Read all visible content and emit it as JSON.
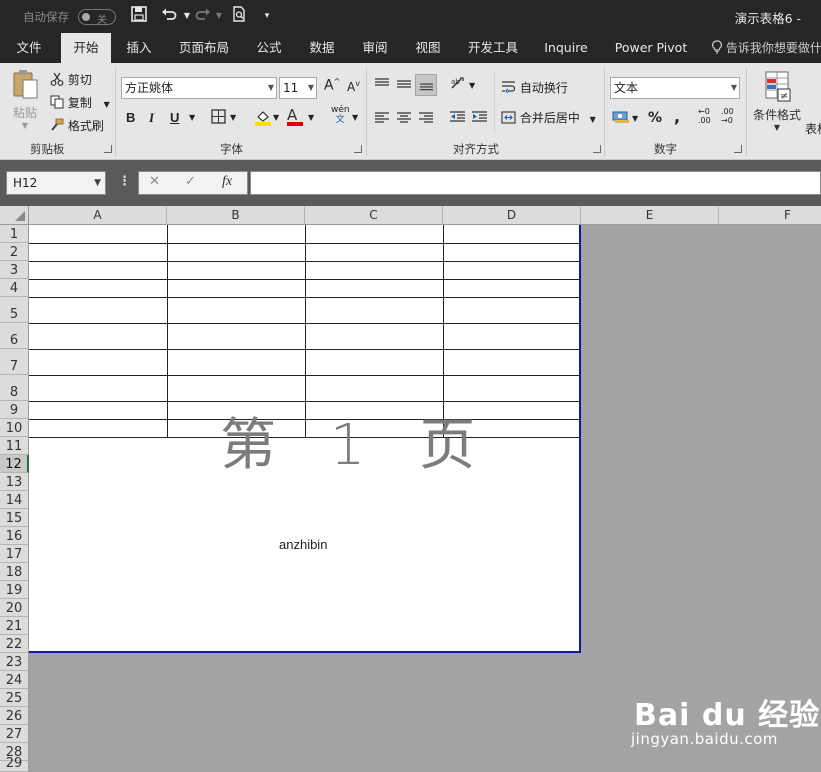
{
  "titlebar": {
    "autosave_label": "自动保存",
    "autosave_state": "关",
    "document_title": "演示表格6 -"
  },
  "tabs": [
    {
      "label": "文件"
    },
    {
      "label": "开始"
    },
    {
      "label": "插入"
    },
    {
      "label": "页面布局"
    },
    {
      "label": "公式"
    },
    {
      "label": "数据"
    },
    {
      "label": "审阅"
    },
    {
      "label": "视图"
    },
    {
      "label": "开发工具"
    },
    {
      "label": "Inquire"
    },
    {
      "label": "Power Pivot"
    }
  ],
  "tell_me": "告诉我你想要做什",
  "ribbon": {
    "clipboard": {
      "paste": "粘贴",
      "cut": "剪切",
      "copy": "复制",
      "format_painter": "格式刷",
      "group": "剪贴板"
    },
    "font": {
      "font_name": "方正姚体",
      "font_size": "11",
      "bold": "B",
      "italic": "I",
      "underline": "U",
      "font_color_letter": "A",
      "phonetic_top": "wén",
      "phonetic_bottom": "文",
      "group": "字体",
      "grow": "A",
      "shrink": "A"
    },
    "alignment": {
      "wrap_text": "自动换行",
      "merge_center": "合并后居中",
      "group": "对齐方式"
    },
    "number": {
      "format": "文本",
      "percent": "%",
      "comma": ",",
      "inc_decimal": ".00",
      "dec_decimal": ".00",
      "group": "数字"
    },
    "styles": {
      "conditional_format": "条件格式",
      "table_format": "表格"
    }
  },
  "formula_bar": {
    "name_box": "H12",
    "fx": "fx",
    "formula": ""
  },
  "columns": [
    "A",
    "B",
    "C",
    "D",
    "E",
    "F"
  ],
  "rows": [
    "1",
    "2",
    "3",
    "4",
    "5",
    "6",
    "7",
    "8",
    "9",
    "10",
    "11",
    "12",
    "13",
    "14",
    "15",
    "16",
    "17",
    "18",
    "19",
    "20",
    "21",
    "22",
    "23",
    "24",
    "25",
    "26",
    "27",
    "28",
    "29"
  ],
  "selected_row": "12",
  "page": {
    "watermark": "第 1 页",
    "footer_text": "anzhibin"
  },
  "watermark_logo": {
    "brand": "Bai du 经验",
    "url": "jingyan.baidu.com"
  },
  "colors": {
    "page_border": "#0b1aa0",
    "chrome_dark": "#262626",
    "ribbon": "#e6e6e6",
    "sheet_background": "#a3a3a3"
  }
}
